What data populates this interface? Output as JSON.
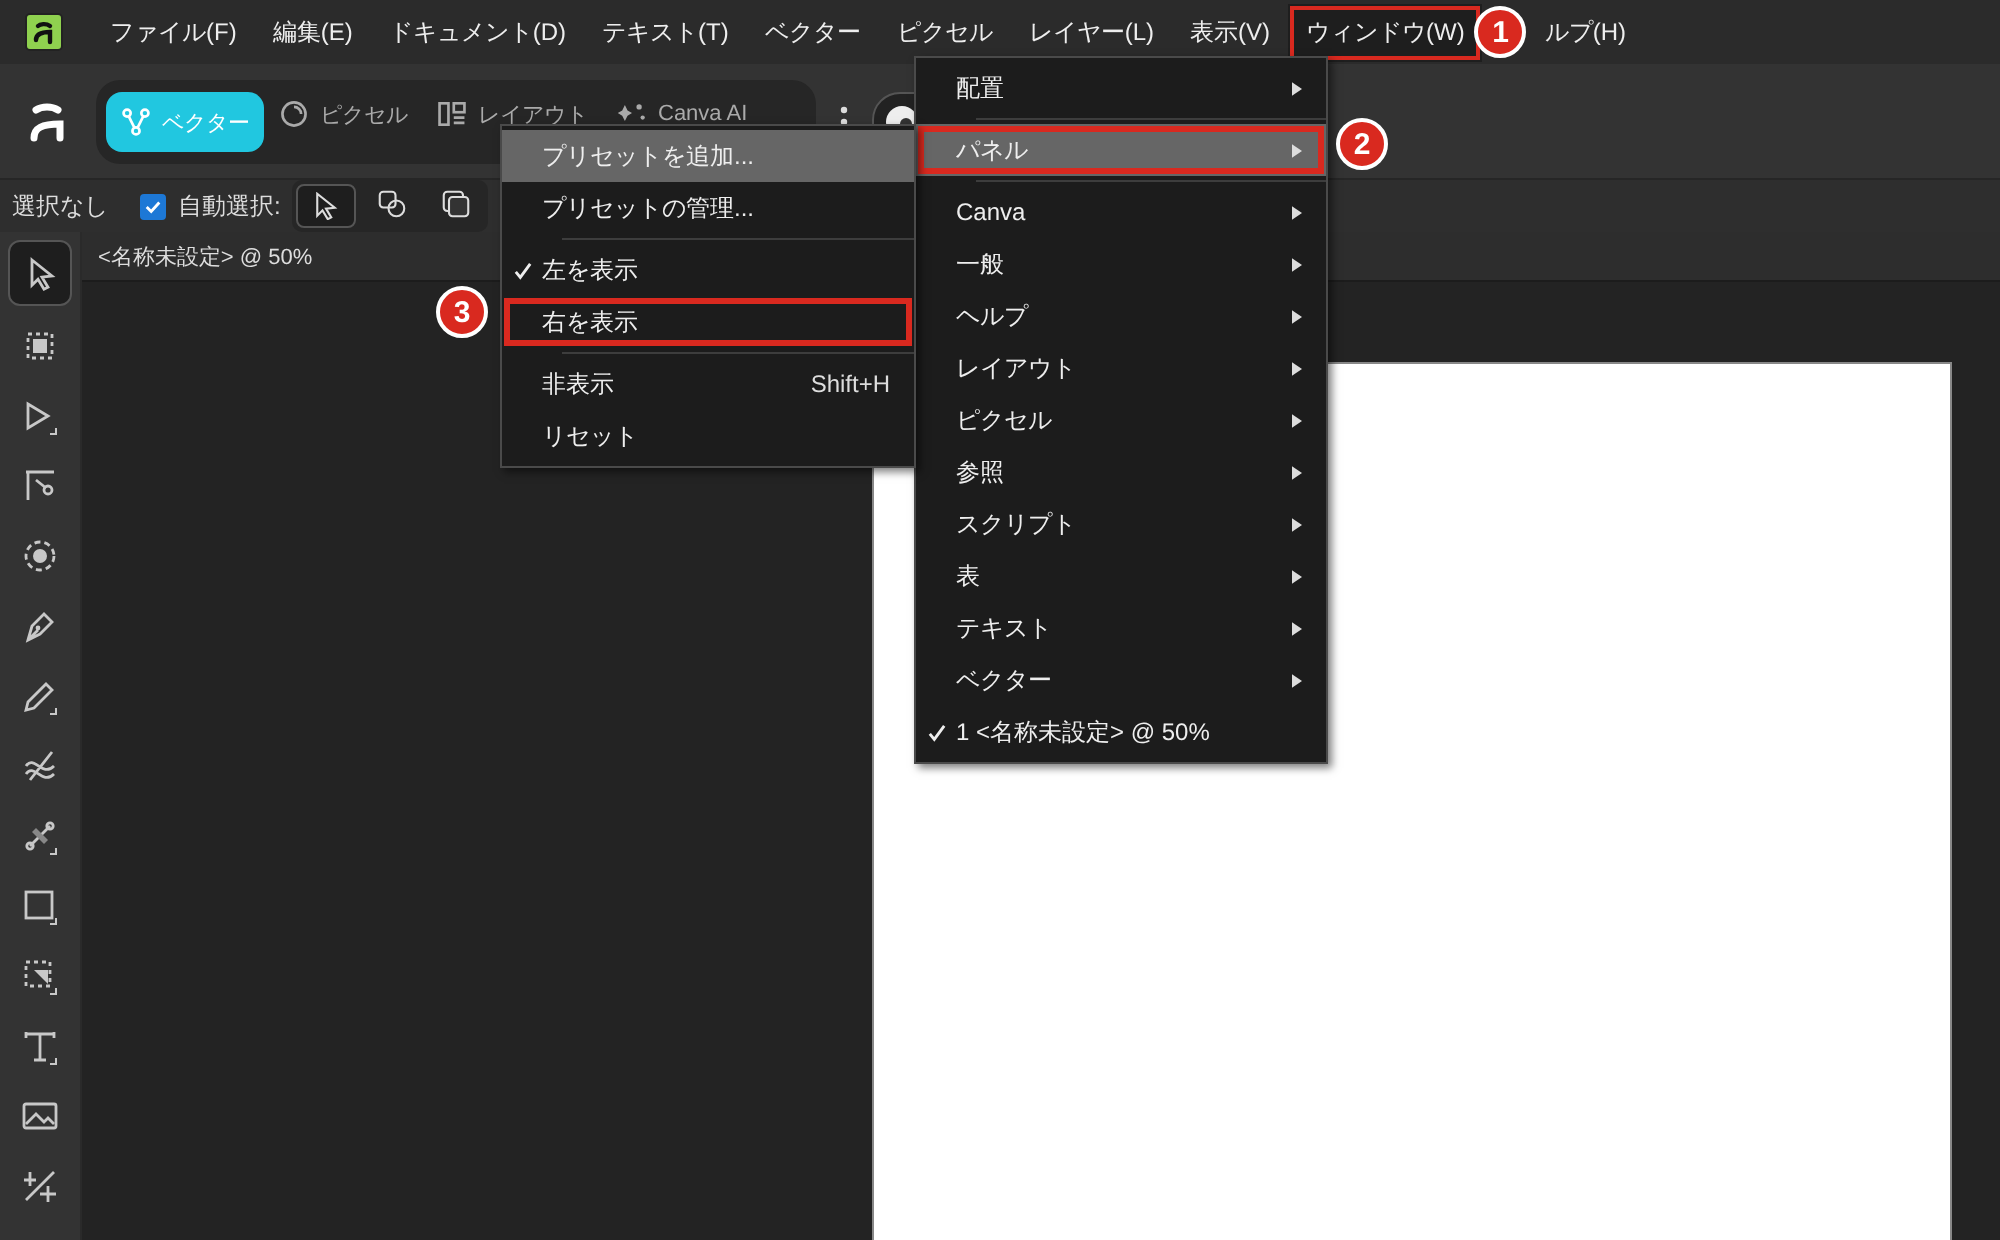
{
  "menubar": {
    "items": [
      {
        "label": "ファイル(F)",
        "selected": false
      },
      {
        "label": "編集(E)",
        "selected": false
      },
      {
        "label": "ドキュメント(D)",
        "selected": false
      },
      {
        "label": "テキスト(T)",
        "selected": false
      },
      {
        "label": "ベクター",
        "selected": false
      },
      {
        "label": "ピクセル",
        "selected": false
      },
      {
        "label": "レイヤー(L)",
        "selected": false
      },
      {
        "label": "表示(V)",
        "selected": false
      },
      {
        "label": "ウィンドウ(W)",
        "selected": true,
        "callout": "1"
      },
      {
        "label": "ルプ(H)",
        "selected": false
      }
    ]
  },
  "personas": [
    {
      "label": "ベクター",
      "kind": "vector",
      "selected": true
    },
    {
      "label": "ピクセル",
      "kind": "pixel",
      "selected": false
    },
    {
      "label": "レイアウト",
      "kind": "layout",
      "selected": false
    },
    {
      "label": "Canva AI",
      "kind": "ai",
      "selected": false
    }
  ],
  "context_bar": {
    "label": "選択なし",
    "auto_select": {
      "label": "自動選択:",
      "checked": true
    }
  },
  "tools": [
    {
      "kind": "move",
      "selected": true
    },
    {
      "kind": "artboard",
      "selected": false
    },
    {
      "kind": "node",
      "selected": false
    },
    {
      "kind": "corner",
      "selected": false
    },
    {
      "kind": "transform",
      "selected": false
    },
    {
      "kind": "pen",
      "selected": false
    },
    {
      "kind": "pencil",
      "selected": false
    },
    {
      "kind": "contour",
      "selected": false
    },
    {
      "kind": "fill",
      "selected": false
    },
    {
      "kind": "rectangle",
      "selected": false
    },
    {
      "kind": "frame",
      "selected": false
    },
    {
      "kind": "text",
      "selected": false
    },
    {
      "kind": "image",
      "selected": false
    },
    {
      "kind": "crop",
      "selected": false
    }
  ],
  "document_tab": {
    "title": "<名称未設定> @ 50%"
  },
  "window_menu": {
    "items": [
      {
        "kind": "item",
        "label": "配置",
        "highlighted": false
      },
      {
        "kind": "separator"
      },
      {
        "kind": "item",
        "label": "パネル",
        "highlighted": true,
        "callout": "2"
      },
      {
        "kind": "separator"
      },
      {
        "kind": "item",
        "label": "Canva",
        "highlighted": false
      },
      {
        "kind": "item",
        "label": "一般",
        "highlighted": false
      },
      {
        "kind": "item",
        "label": "ヘルプ",
        "highlighted": false
      },
      {
        "kind": "item",
        "label": "レイアウト",
        "highlighted": false
      },
      {
        "kind": "item",
        "label": "ピクセル",
        "highlighted": false
      },
      {
        "kind": "item",
        "label": "参照",
        "highlighted": false
      },
      {
        "kind": "item",
        "label": "スクリプト",
        "highlighted": false
      },
      {
        "kind": "item",
        "label": "表",
        "highlighted": false
      },
      {
        "kind": "item",
        "label": "テキスト",
        "highlighted": false
      },
      {
        "kind": "item",
        "label": "ベクター",
        "highlighted": false
      },
      {
        "kind": "doc",
        "label": "1 <名称未設定> @ 50%",
        "checked": true
      }
    ]
  },
  "panel_submenu": {
    "items": [
      {
        "kind": "item",
        "label": "プリセットを追加...",
        "highlighted": true
      },
      {
        "kind": "item",
        "label": "プリセットの管理...",
        "highlighted": false
      },
      {
        "kind": "separator"
      },
      {
        "kind": "check",
        "label": "左を表示",
        "checked": true
      },
      {
        "kind": "check",
        "label": "右を表示",
        "checked": false,
        "callout": "3"
      },
      {
        "kind": "separator"
      },
      {
        "kind": "item",
        "label": "非表示",
        "shortcut": "Shift+H",
        "highlighted": false
      },
      {
        "kind": "item",
        "label": "リセット",
        "highlighted": false
      }
    ]
  }
}
